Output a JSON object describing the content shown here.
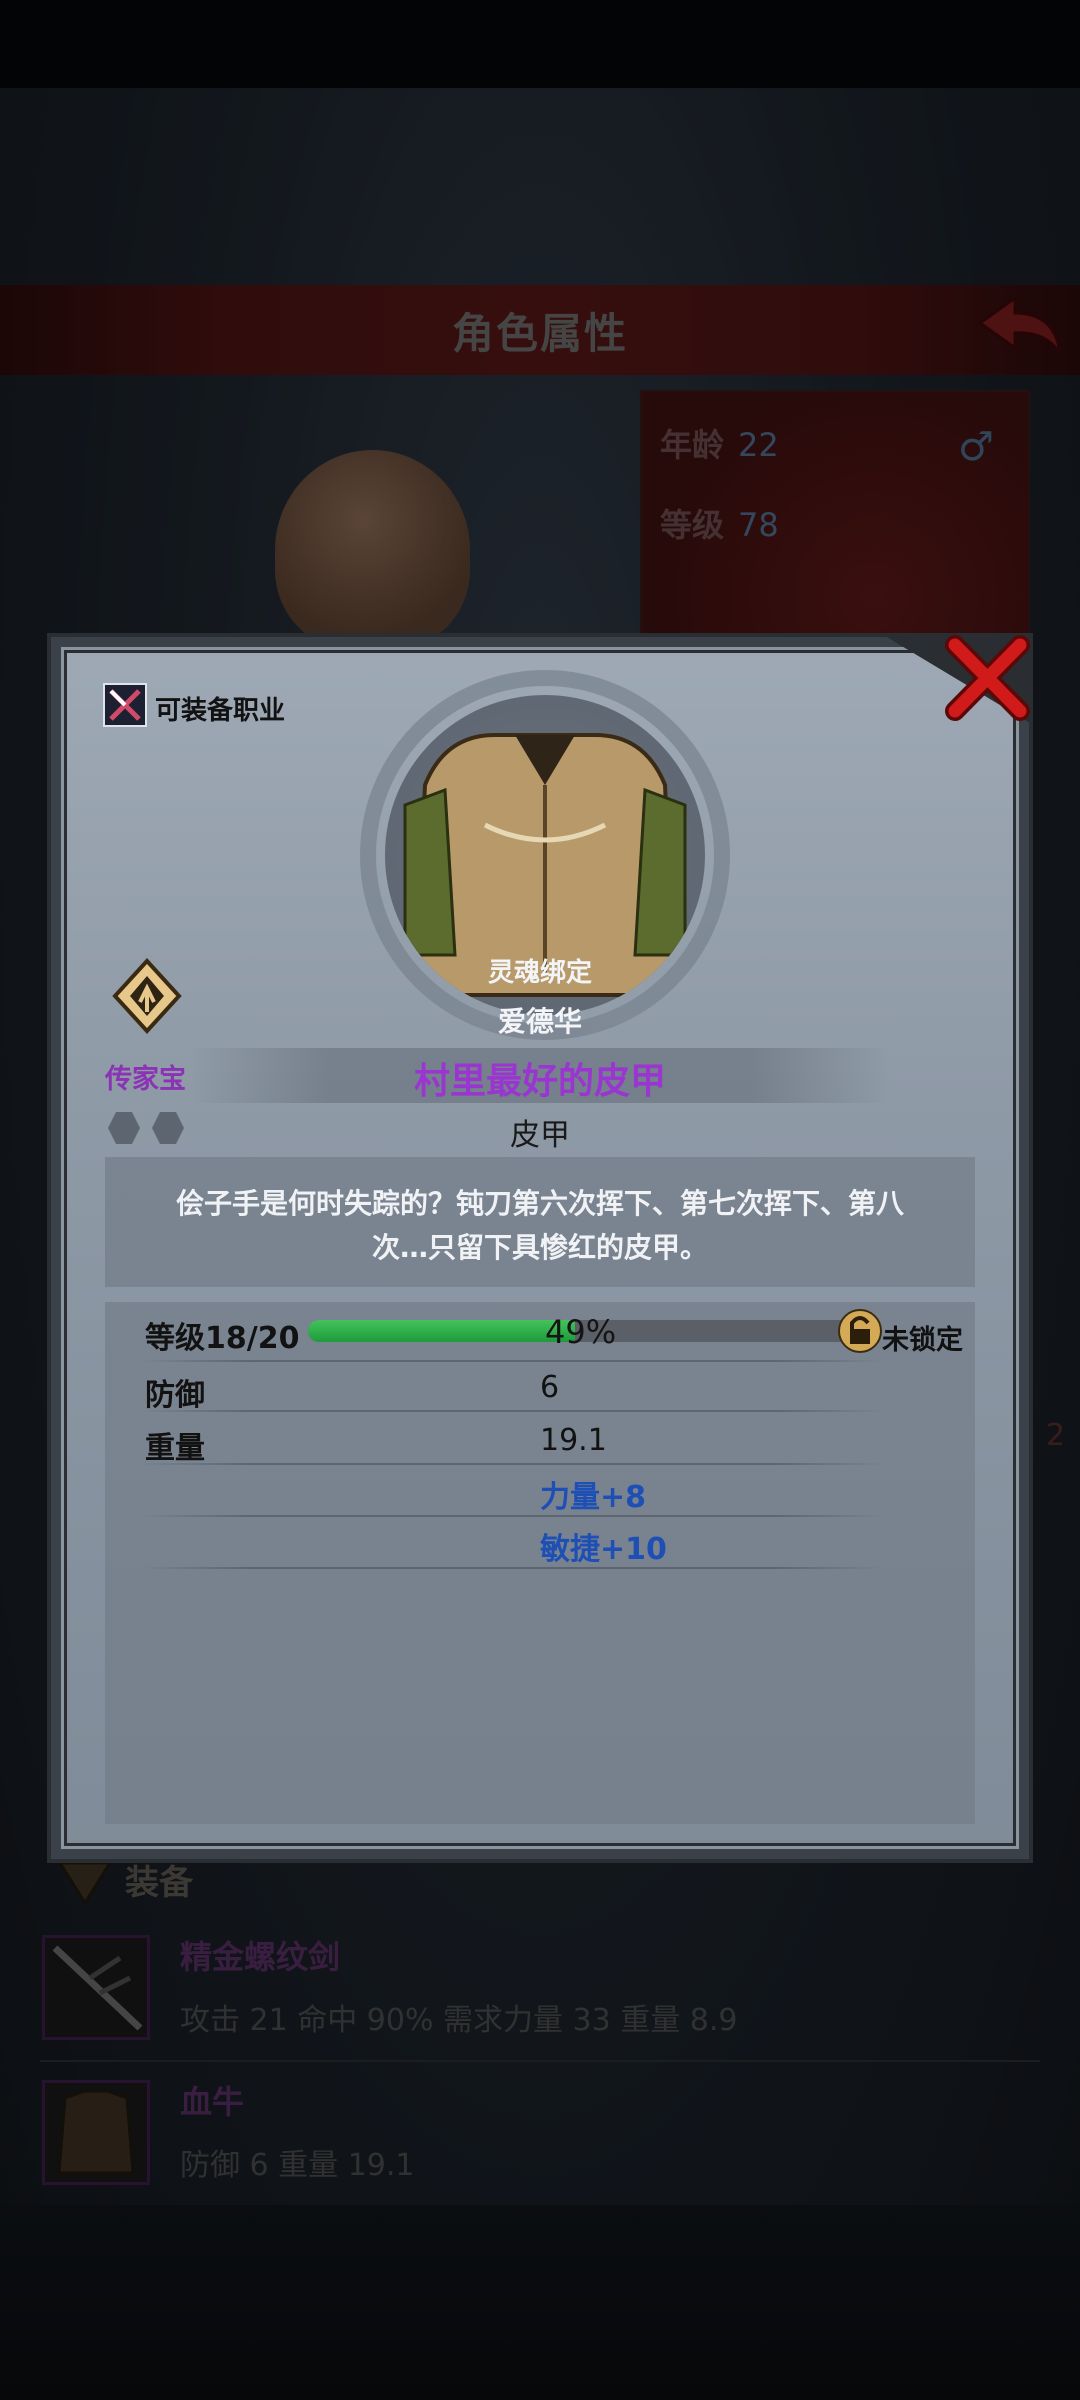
{
  "header": {
    "title": "角色属性"
  },
  "character": {
    "age_label": "年龄",
    "age": "22",
    "level_label": "等级",
    "level": "78",
    "gender_icon": "male-symbol-icon"
  },
  "side_number": "2",
  "equipment_list": {
    "section_label": "装备",
    "items": [
      {
        "name": "精金螺纹剑",
        "stats": "攻击 21 命中 90% 需求力量 33 重量 8.9"
      },
      {
        "name": "血牛",
        "stats": "防御 6 重量 19.1"
      }
    ]
  },
  "popup": {
    "class_label": "可装备职业",
    "soulbound": "灵魂绑定",
    "owner": "爱德华",
    "heirloom_label": "传家宝",
    "item_name": "村里最好的皮甲",
    "item_type": "皮甲",
    "description": "侩子手是何时失踪的？钝刀第六次挥下、第七次挥下、第八次…只留下具惨红的皮甲。",
    "level_label": "等级18/20",
    "level_progress": 0.49,
    "level_percent": "49%",
    "lock_label": "未锁定",
    "stats": [
      {
        "label": "防御",
        "value": "6"
      },
      {
        "label": "重量",
        "value": "19.1"
      }
    ],
    "bonuses": [
      "力量+8",
      "敏捷+10"
    ]
  },
  "colors": {
    "rarity_purple": "#9a35d1",
    "bonus_blue": "#1e4fb4",
    "progress_green": "#2aa845",
    "close_red": "#d11a1a"
  }
}
